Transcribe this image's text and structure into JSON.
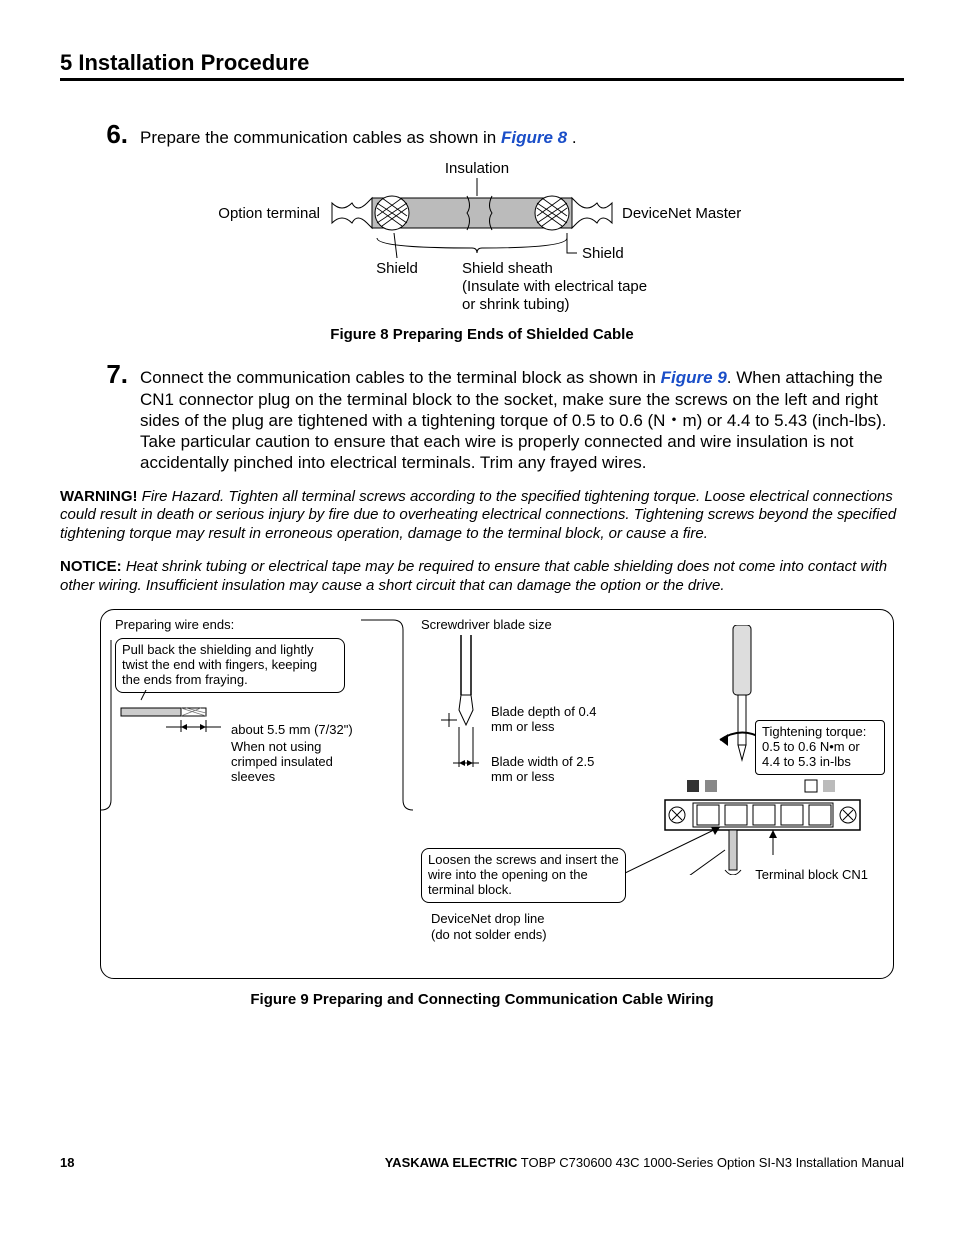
{
  "header": {
    "section": "5  Installation Procedure"
  },
  "steps": [
    {
      "num": "6.",
      "text_a": "Prepare the communication cables as shown in ",
      "link": "Figure 8",
      "text_b": " ."
    },
    {
      "num": "7.",
      "text_a": "Connect the communication cables to the terminal block as shown in ",
      "link": "Figure 9",
      "text_b": ". When attaching the CN1 connector plug on the terminal block to the socket, make sure the screws on the left and right sides of the plug are tightened with a tightening torque of 0.5 to 0.6 (N・m) or 4.4 to 5.43 (inch-lbs). Take particular caution to ensure that each wire is properly connected and wire insulation is not accidentally pinched into electrical terminals. Trim any frayed wires."
    }
  ],
  "fig8": {
    "caption": "Figure 8  Preparing Ends of Shielded Cable",
    "labels": {
      "insulation": "Insulation",
      "option_terminal": "Option terminal",
      "devicenet_master": "DeviceNet Master",
      "shield_left": "Shield",
      "shield_right": "Shield",
      "sheath_a": "Shield sheath",
      "sheath_b": "(Insulate with electrical tape",
      "sheath_c": "or shrink tubing)"
    }
  },
  "fig9": {
    "caption": "Figure 9  Preparing and Connecting Communication Cable Wiring",
    "labels": {
      "prep": "Preparing wire ends:",
      "pull": "Pull back the shielding and lightly twist the end with fingers, keeping the ends from fraying.",
      "about": "about 5.5 mm (7/32\")",
      "when": "When not using crimped insulated sleeves",
      "screwdriver": "Screwdriver blade size",
      "blade_depth": "Blade depth of 0.4 mm or less",
      "blade_width": "Blade width of 2.5 mm or less",
      "loosen": "Loosen the screws and insert the wire into the opening on the terminal block.",
      "dropline_a": "DeviceNet drop line",
      "dropline_b": "(do not solder ends)",
      "torque": "Tightening torque: 0.5 to 0.6 N•m or 4.4 to 5.3 in-lbs",
      "terminal": "Terminal block CN1"
    }
  },
  "warning": {
    "label": "WARNING!",
    "text": " Fire Hazard. Tighten all terminal screws according to the specified tightening torque. Loose electrical connections could result in death or serious injury by fire due to overheating electrical connections. Tightening screws beyond the specified tightening torque may result in erroneous operation, damage to the terminal block, or cause a fire."
  },
  "notice": {
    "label": "NOTICE:",
    "text": " Heat shrink tubing or electrical tape may be required to ensure that cable shielding does not come into contact with other wiring. Insufficient insulation may cause a short circuit that can damage the option or the drive."
  },
  "footer": {
    "page": "18",
    "doc_bold": "YASKAWA ELECTRIC",
    "doc_rest": " TOBP C730600 43C 1000-Series Option SI-N3 Installation Manual"
  }
}
